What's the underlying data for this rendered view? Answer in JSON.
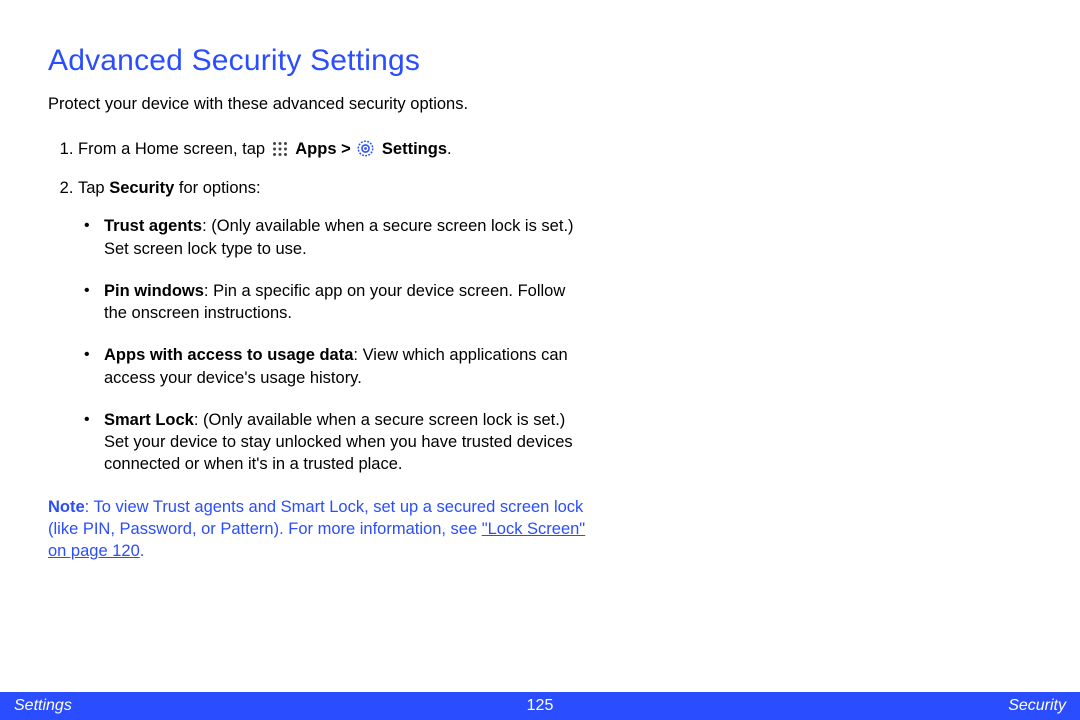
{
  "title": "Advanced Security Settings",
  "intro": "Protect your device with these advanced security options.",
  "step1": {
    "prefix": "From a Home screen, tap ",
    "apps_label": "Apps",
    "sep": " > ",
    "settings_label": "Settings",
    "suffix": "."
  },
  "step2": {
    "prefix": "Tap ",
    "bold": "Security",
    "suffix": " for options:"
  },
  "bullets": [
    {
      "heading": "Trust agents",
      "body": ": (Only available when a secure screen lock is set.) Set screen lock type to use."
    },
    {
      "heading": "Pin windows",
      "body": ": Pin a specific app on your device screen. Follow the onscreen instructions."
    },
    {
      "heading": "Apps with access to usage data",
      "body": ": View which applications can access your device's usage history."
    },
    {
      "heading": "Smart Lock",
      "body": ": (Only available when a secure screen lock is set.) Set your device to stay unlocked when you have trusted devices connected or when it's in a trusted place."
    }
  ],
  "note": {
    "label": "Note",
    "body": ": To view Trust agents and Smart Lock, set up a secured screen lock (like PIN, Password, or Pattern). For more information, see ",
    "link": "\"Lock Screen\" on page 120",
    "tail": "."
  },
  "footer": {
    "left": "Settings",
    "center": "125",
    "right": "Security"
  }
}
